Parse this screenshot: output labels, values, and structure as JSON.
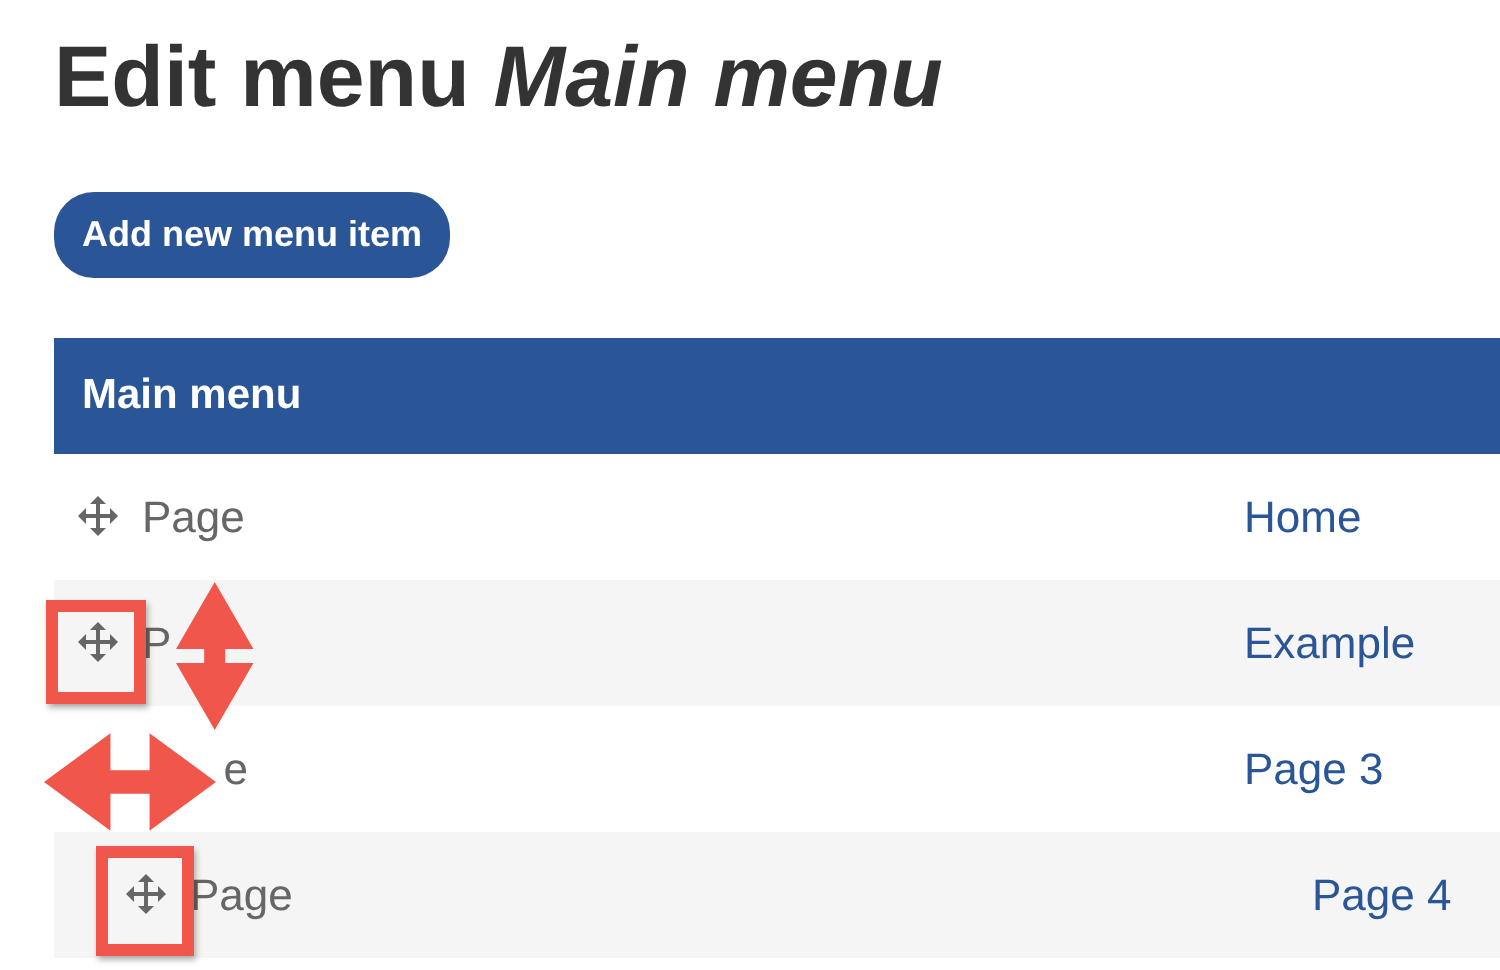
{
  "title": "Edit menu *Main menu*",
  "add_button": "Add new menu item",
  "table": {
    "header": "Main menu",
    "rows": [
      {
        "type": "Page",
        "link": "Home"
      },
      {
        "type": "P",
        "link": "Example"
      },
      {
        "type": "e",
        "cut_start": true,
        "handle": false,
        "link": "Page 3",
        "children": [
          {
            "type": "Page",
            "link": "Page 4"
          }
        ]
      }
    ]
  },
  "annotations": [
    {
      "kind": "box"
    },
    {
      "kind": "vertical-arrow"
    },
    {
      "kind": "horizontal-arrow"
    },
    {
      "kind": "box"
    }
  ]
}
